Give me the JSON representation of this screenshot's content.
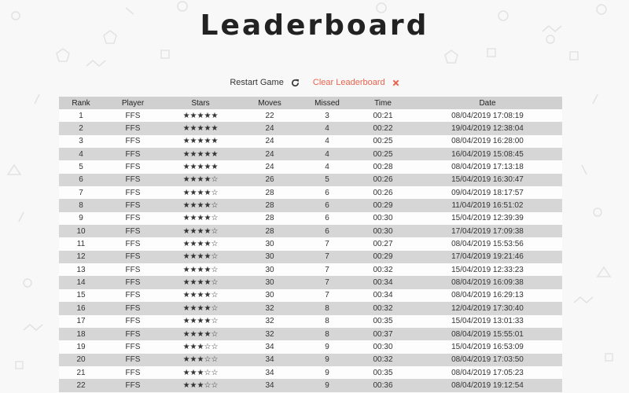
{
  "title": "Leaderboard",
  "controls": {
    "restart_label": "Restart Game",
    "clear_label": "Clear Leaderboard"
  },
  "colors": {
    "clear": "#e8634e",
    "header_bg": "#d0d0d0",
    "row_alt_bg": "#d6d6d6"
  },
  "columns": [
    "Rank",
    "Player",
    "Stars",
    "Moves",
    "Missed",
    "Time",
    "Date"
  ],
  "rows": [
    {
      "rank": "1",
      "player": "FFS",
      "stars": 5,
      "moves": "22",
      "missed": "3",
      "time": "00:21",
      "date": "08/04/2019 17:08:19"
    },
    {
      "rank": "2",
      "player": "FFS",
      "stars": 5,
      "moves": "24",
      "missed": "4",
      "time": "00:22",
      "date": "19/04/2019 12:38:04"
    },
    {
      "rank": "3",
      "player": "FFS",
      "stars": 5,
      "moves": "24",
      "missed": "4",
      "time": "00:25",
      "date": "08/04/2019 16:28:00"
    },
    {
      "rank": "4",
      "player": "FFS",
      "stars": 5,
      "moves": "24",
      "missed": "4",
      "time": "00:25",
      "date": "16/04/2019 15:08:45"
    },
    {
      "rank": "5",
      "player": "FFS",
      "stars": 5,
      "moves": "24",
      "missed": "4",
      "time": "00:28",
      "date": "08/04/2019 17:13:18"
    },
    {
      "rank": "6",
      "player": "FFS",
      "stars": 4,
      "moves": "26",
      "missed": "5",
      "time": "00:26",
      "date": "15/04/2019 16:30:47"
    },
    {
      "rank": "7",
      "player": "FFS",
      "stars": 4,
      "moves": "28",
      "missed": "6",
      "time": "00:26",
      "date": "09/04/2019 18:17:57"
    },
    {
      "rank": "8",
      "player": "FFS",
      "stars": 4,
      "moves": "28",
      "missed": "6",
      "time": "00:29",
      "date": "11/04/2019 16:51:02"
    },
    {
      "rank": "9",
      "player": "FFS",
      "stars": 4,
      "moves": "28",
      "missed": "6",
      "time": "00:30",
      "date": "15/04/2019 12:39:39"
    },
    {
      "rank": "10",
      "player": "FFS",
      "stars": 4,
      "moves": "28",
      "missed": "6",
      "time": "00:30",
      "date": "17/04/2019 17:09:38"
    },
    {
      "rank": "11",
      "player": "FFS",
      "stars": 4,
      "moves": "30",
      "missed": "7",
      "time": "00:27",
      "date": "08/04/2019 15:53:56"
    },
    {
      "rank": "12",
      "player": "FFS",
      "stars": 4,
      "moves": "30",
      "missed": "7",
      "time": "00:29",
      "date": "17/04/2019 19:21:46"
    },
    {
      "rank": "13",
      "player": "FFS",
      "stars": 4,
      "moves": "30",
      "missed": "7",
      "time": "00:32",
      "date": "15/04/2019 12:33:23"
    },
    {
      "rank": "14",
      "player": "FFS",
      "stars": 4,
      "moves": "30",
      "missed": "7",
      "time": "00:34",
      "date": "08/04/2019 16:09:38"
    },
    {
      "rank": "15",
      "player": "FFS",
      "stars": 4,
      "moves": "30",
      "missed": "7",
      "time": "00:34",
      "date": "08/04/2019 16:29:13"
    },
    {
      "rank": "16",
      "player": "FFS",
      "stars": 4,
      "moves": "32",
      "missed": "8",
      "time": "00:32",
      "date": "12/04/2019 17:30:40"
    },
    {
      "rank": "17",
      "player": "FFS",
      "stars": 4,
      "moves": "32",
      "missed": "8",
      "time": "00:35",
      "date": "15/04/2019 13:01:33"
    },
    {
      "rank": "18",
      "player": "FFS",
      "stars": 4,
      "moves": "32",
      "missed": "8",
      "time": "00:37",
      "date": "08/04/2019 15:55:01"
    },
    {
      "rank": "19",
      "player": "FFS",
      "stars": 3,
      "moves": "34",
      "missed": "9",
      "time": "00:30",
      "date": "15/04/2019 16:53:09"
    },
    {
      "rank": "20",
      "player": "FFS",
      "stars": 3,
      "moves": "34",
      "missed": "9",
      "time": "00:32",
      "date": "08/04/2019 17:03:50"
    },
    {
      "rank": "21",
      "player": "FFS",
      "stars": 3,
      "moves": "34",
      "missed": "9",
      "time": "00:35",
      "date": "08/04/2019 17:05:23"
    },
    {
      "rank": "22",
      "player": "FFS",
      "stars": 3,
      "moves": "34",
      "missed": "9",
      "time": "00:36",
      "date": "08/04/2019 19:12:54"
    }
  ],
  "max_stars": 5
}
